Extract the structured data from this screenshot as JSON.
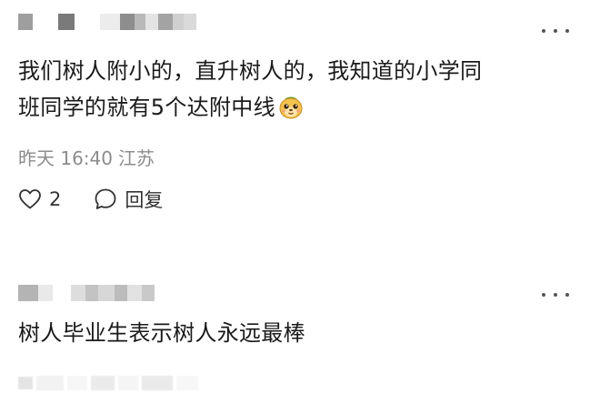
{
  "comments": [
    {
      "author_masked": true,
      "text_line1": "我们树人附小的，直升树人的，我知道的小学同",
      "text_line2": "班同学的就有5个达附中线",
      "emoji": "smiling-dog-sticker",
      "time": "昨天 16:40",
      "location": "江苏",
      "like_count": "2",
      "reply_label": "回复"
    },
    {
      "author_masked": true,
      "text_line1": "树人毕业生表示树人永远最棒"
    }
  ],
  "icons": {
    "more": "more-dots-icon",
    "like": "heart-outline-icon",
    "reply": "chat-bubble-icon"
  },
  "colors": {
    "text": "#1a1a1a",
    "meta": "#8c8c8c",
    "icon": "#333333"
  }
}
